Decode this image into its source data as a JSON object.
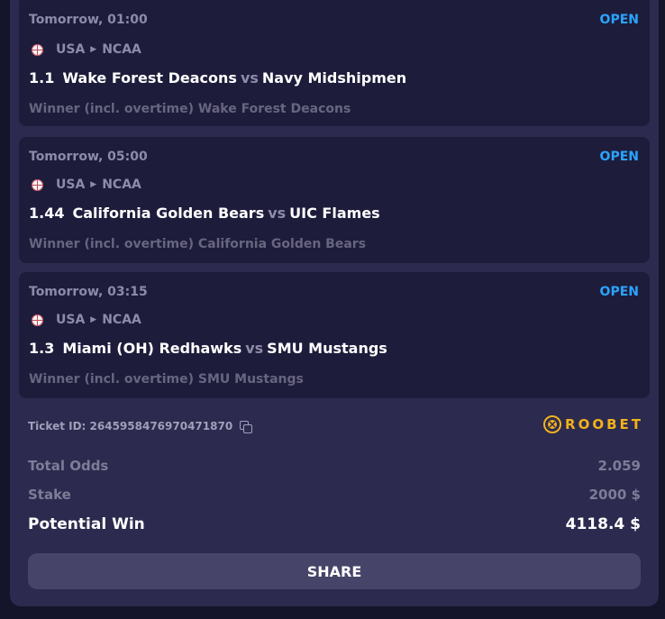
{
  "bets": [
    {
      "time": "Tomorrow, 01:00",
      "status": "OPEN",
      "country": "USA",
      "league": "NCAA",
      "odds": "1.1",
      "home": "Wake Forest Deacons",
      "vs": "vs",
      "away": "Navy Midshipmen",
      "market": "Winner (incl. overtime) Wake Forest Deacons"
    },
    {
      "time": "Tomorrow, 05:00",
      "status": "OPEN",
      "country": "USA",
      "league": "NCAA",
      "odds": "1.44",
      "home": "California Golden Bears",
      "vs": "vs",
      "away": "UIC Flames",
      "market": "Winner (incl. overtime) California Golden Bears"
    },
    {
      "time": "Tomorrow, 03:15",
      "status": "OPEN",
      "country": "USA",
      "league": "NCAA",
      "odds": "1.3",
      "home": "Miami (OH) Redhawks",
      "vs": "vs",
      "away": "SMU Mustangs",
      "market": "Winner (incl. overtime) SMU Mustangs"
    }
  ],
  "ticket": {
    "id_label": "Ticket ID: 2645958476970471870",
    "brand": "ROOBET"
  },
  "summary": {
    "total_odds_label": "Total Odds",
    "total_odds_value": "2.059",
    "stake_label": "Stake",
    "stake_value": "2000 $",
    "potential_win_label": "Potential Win",
    "potential_win_value": "4118.4 $"
  },
  "share_label": "SHARE",
  "icons": {
    "sport": "basketball-icon",
    "separator": "chevron-right-icon",
    "copy": "copy-icon",
    "brand": "roobet-logo-icon"
  },
  "colors": {
    "status_open": "#2aa4ff",
    "brand": "#f2b21c",
    "card": "#1d1c3b",
    "panel": "#2c2a4e"
  }
}
